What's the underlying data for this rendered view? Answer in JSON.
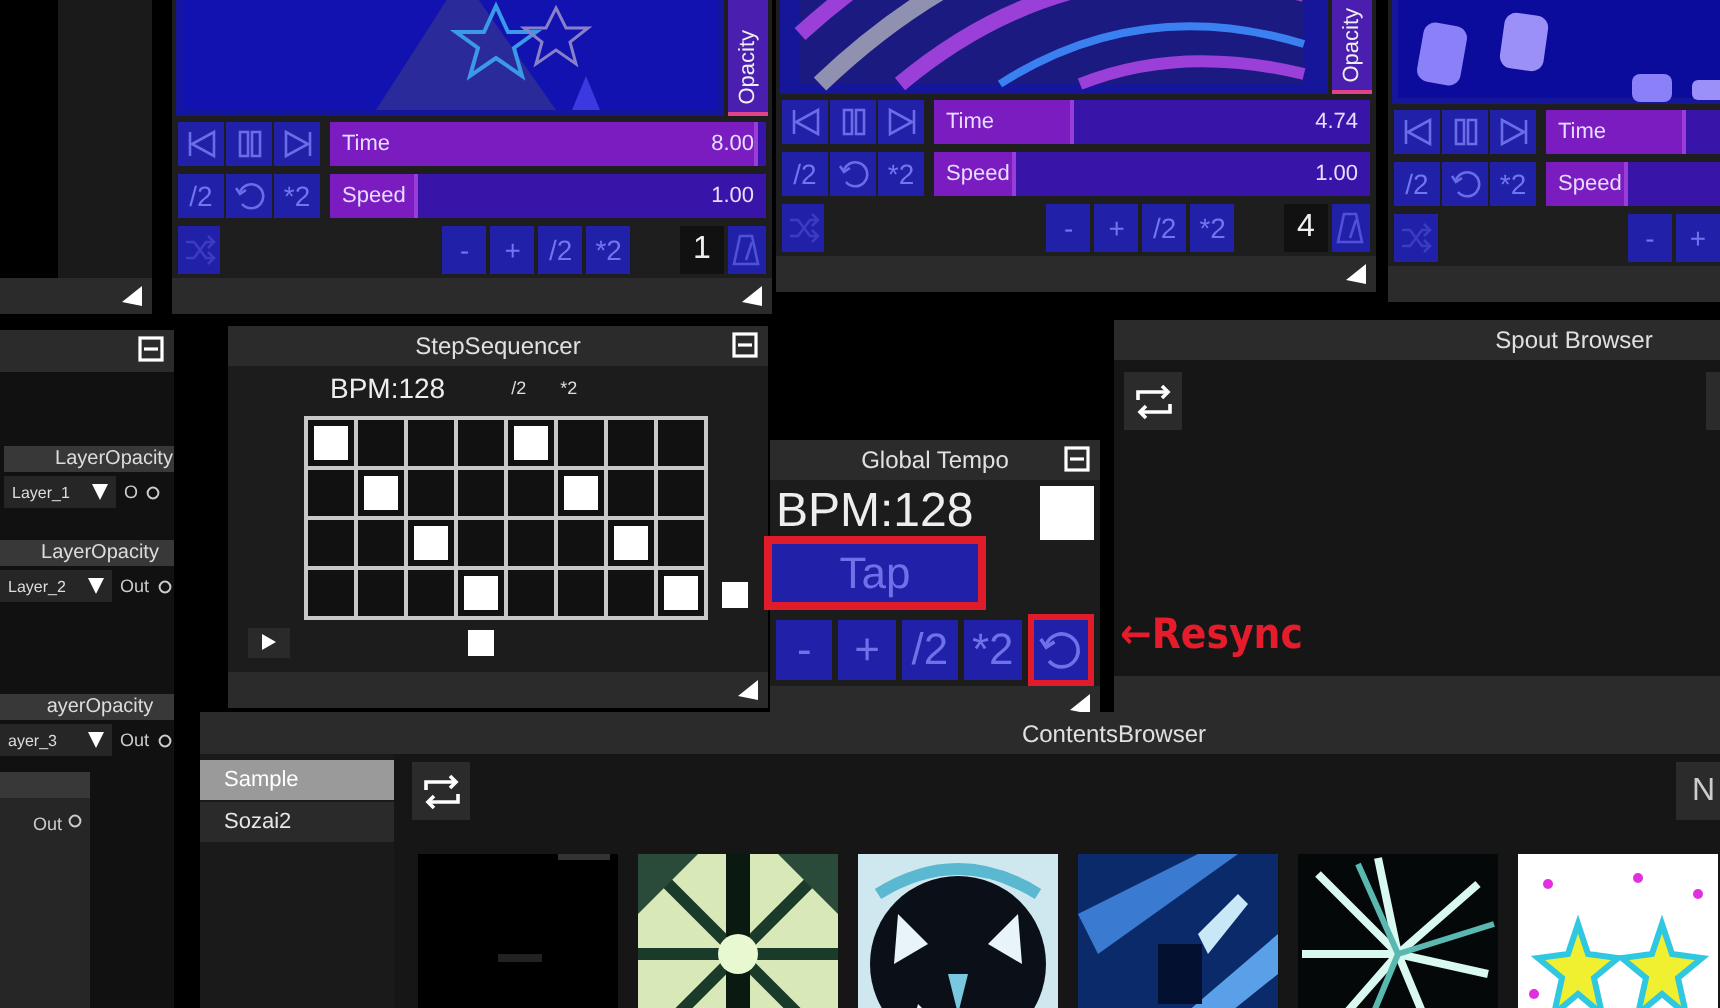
{
  "clip_panels": [
    {
      "opacity_label": "Opacity",
      "time": {
        "label": "Time",
        "reading": "8.00",
        "level": 0.98
      },
      "speed": {
        "label": "Speed",
        "reading": "1.00",
        "level": 0.2
      },
      "rate_buttons": [
        "/2",
        "*2"
      ],
      "beat_buttons": [
        "-",
        "+",
        "/2",
        "*2"
      ],
      "beat_count": "1"
    },
    {
      "opacity_label": "Opacity",
      "time": {
        "label": "Time",
        "reading": "4.74",
        "level": 0.32
      },
      "speed": {
        "label": "Speed",
        "reading": "1.00",
        "level": 0.19
      },
      "rate_buttons": [
        "/2",
        "*2"
      ],
      "beat_buttons": [
        "-",
        "+",
        "/2",
        "*2"
      ],
      "beat_count": "4"
    },
    {
      "time": {
        "label": "Time",
        "level": 0.32
      },
      "speed": {
        "label": "Speed",
        "level": 0.19
      },
      "rate_buttons": [
        "/2",
        "*2"
      ],
      "beat_buttons": [
        "-",
        "+"
      ]
    }
  ],
  "node_panel": {
    "nodes": [
      {
        "title": "LayerOpacity",
        "layer": "Layer_1",
        "output": "O"
      },
      {
        "title": "LayerOpacity",
        "layer": "Layer_2",
        "output": "Out"
      },
      {
        "title": "ayerOpacity",
        "layer": "ayer_3",
        "output": "Out"
      },
      {
        "output": "Out"
      }
    ]
  },
  "step_sequencer": {
    "title": "StepSequencer",
    "bpm": "BPM:128",
    "rate_buttons": [
      "/2",
      "*2"
    ],
    "rows": [
      {
        "lit": false,
        "steps": [
          {
            "on": true
          },
          {
            "on": false
          },
          {
            "on": false
          },
          {
            "on": false
          },
          {
            "on": true
          },
          {
            "on": false
          },
          {
            "on": false
          },
          {
            "on": false
          }
        ]
      },
      {
        "lit": false,
        "steps": [
          {
            "on": false
          },
          {
            "on": true
          },
          {
            "on": false
          },
          {
            "on": false
          },
          {
            "on": false
          },
          {
            "on": true
          },
          {
            "on": false
          },
          {
            "on": false
          }
        ]
      },
      {
        "lit": false,
        "steps": [
          {
            "on": false
          },
          {
            "on": false
          },
          {
            "on": true
          },
          {
            "on": false
          },
          {
            "on": false
          },
          {
            "on": false
          },
          {
            "on": true
          },
          {
            "on": false
          }
        ]
      },
      {
        "lit": true,
        "steps": [
          {
            "on": false
          },
          {
            "on": false
          },
          {
            "on": false
          },
          {
            "on": true
          },
          {
            "on": false
          },
          {
            "on": false
          },
          {
            "on": false
          },
          {
            "on": true
          }
        ]
      }
    ],
    "column_markers": [
      {
        "lit": false
      },
      {
        "lit": false
      },
      {
        "lit": false
      },
      {
        "lit": true
      },
      {
        "lit": false
      },
      {
        "lit": false
      },
      {
        "lit": false
      },
      {
        "lit": false
      }
    ]
  },
  "global_tempo": {
    "title": "Global Tempo",
    "bpm": "BPM:128",
    "beat_light": {
      "lit": true
    },
    "tap": {
      "label": "Tap",
      "highlighted": true
    },
    "buttons": [
      {
        "label": "-"
      },
      {
        "label": "+"
      },
      {
        "label": "/2"
      },
      {
        "label": "*2"
      }
    ],
    "resync": {
      "highlighted": true
    }
  },
  "annotation": {
    "text": "←Resync"
  },
  "spout_browser": {
    "title": "Spout Browser"
  },
  "contents_browser": {
    "title": "ContentsBrowser",
    "folders": [
      {
        "label": "Sample",
        "selected": true
      },
      {
        "label": "Sozai2",
        "selected": false
      }
    ],
    "cut_button": "N"
  }
}
